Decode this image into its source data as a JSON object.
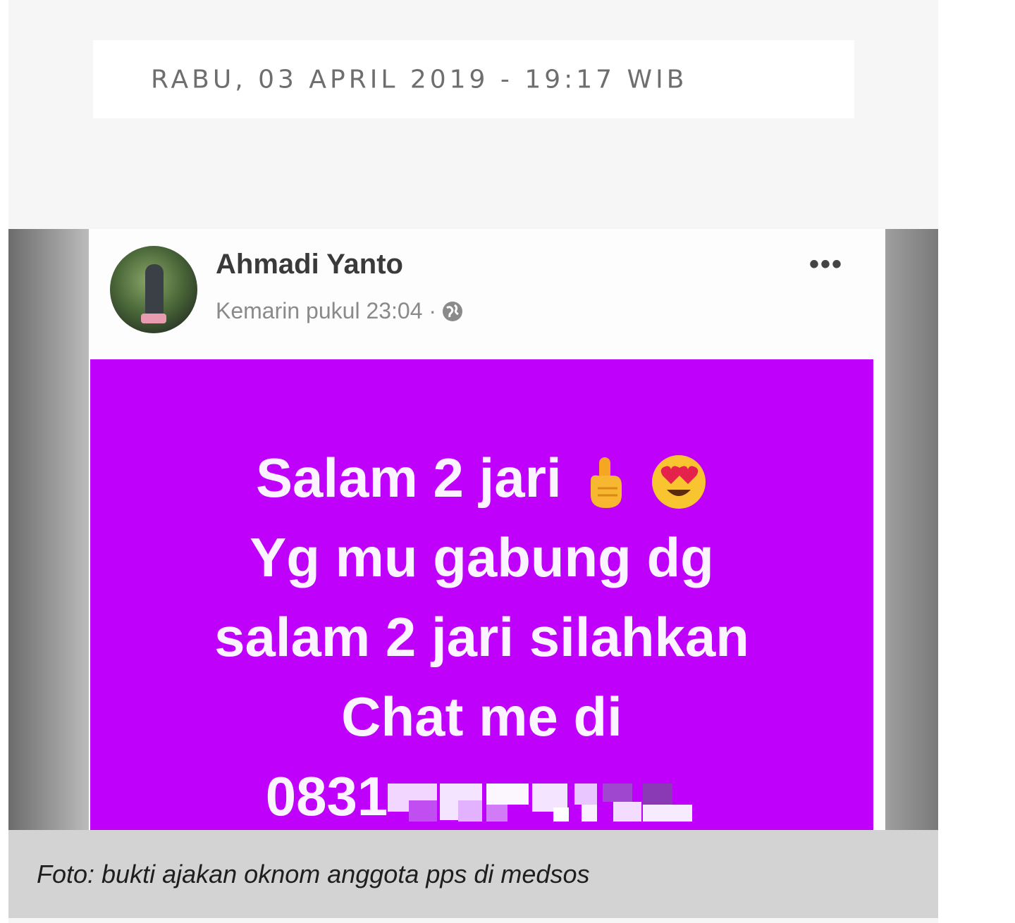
{
  "article": {
    "date_line": "RABU, 03 APRIL 2019 - 19:17 WIB"
  },
  "photo": {
    "post": {
      "author": "Ahmadi Yanto",
      "timestamp": "Kemarin pukul 23:04 ·",
      "more_label": "•••",
      "privacy_icon": "globe-icon",
      "background_color": "#bf00fa",
      "lines": [
        "Salam 2 jari",
        "Yg mu gabung dg",
        "salam 2 jari silahkan",
        "Chat me di",
        "0831"
      ],
      "emojis": [
        "pointing-hand-icon",
        "heart-eyes-icon"
      ]
    }
  },
  "caption": {
    "text": "Foto: bukti ajakan oknom anggota pps di medsos"
  }
}
